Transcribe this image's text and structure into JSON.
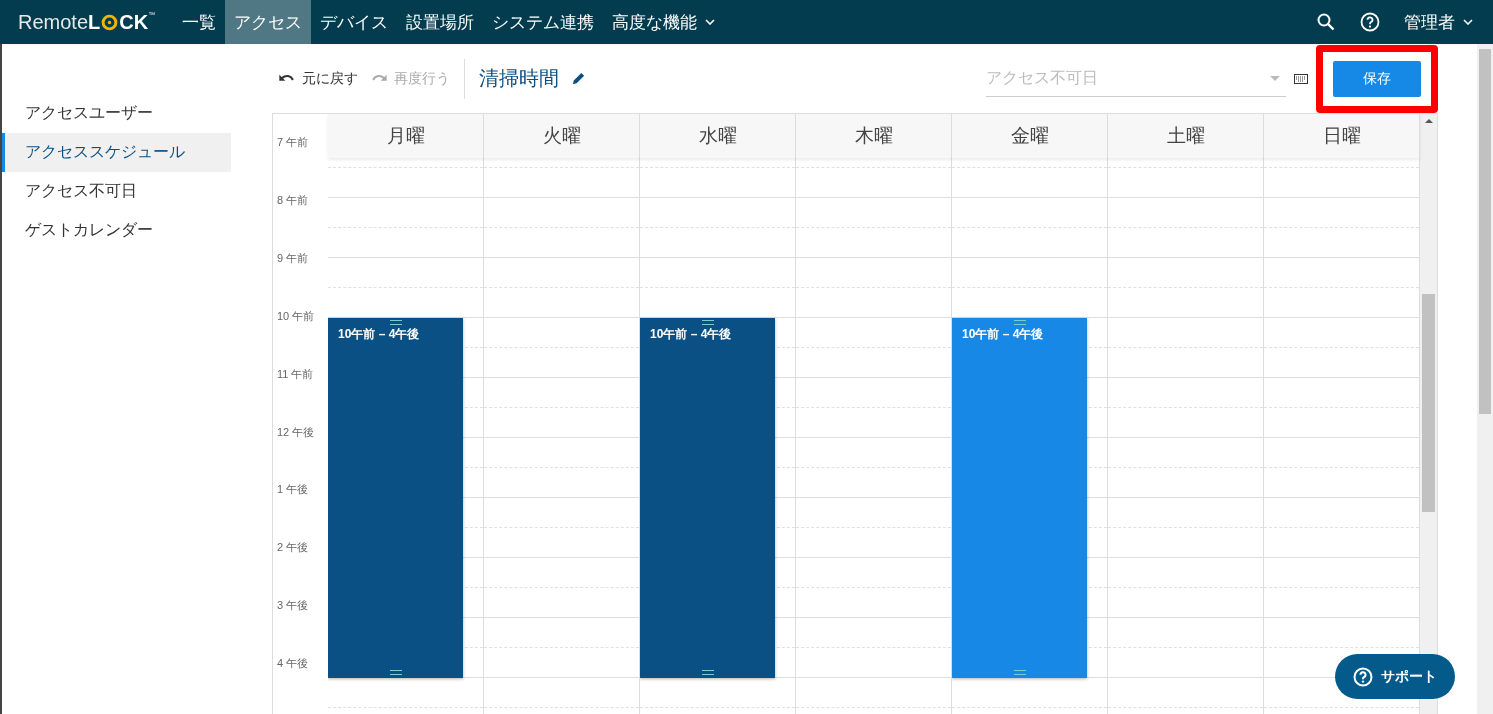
{
  "logo": {
    "before": "Remote",
    "bold_start": "L",
    "bold_end": "CK",
    "mark": "™"
  },
  "nav": [
    {
      "label": "一覧",
      "selected": false,
      "kind": "link"
    },
    {
      "label": "アクセス",
      "selected": true,
      "kind": "link"
    },
    {
      "label": "デバイス",
      "selected": false,
      "kind": "link"
    },
    {
      "label": "設置場所",
      "selected": false,
      "kind": "link"
    },
    {
      "label": "システム連携",
      "selected": false,
      "kind": "link"
    },
    {
      "label": "高度な機能",
      "selected": false,
      "kind": "menu"
    }
  ],
  "user_menu": {
    "label": "管理者"
  },
  "sidebar": {
    "items": [
      {
        "label": "アクセスユーザー",
        "selected": false
      },
      {
        "label": "アクセススケジュール",
        "selected": true
      },
      {
        "label": "アクセス不可日",
        "selected": false
      },
      {
        "label": "ゲストカレンダー",
        "selected": false
      }
    ]
  },
  "toolbar": {
    "undo": {
      "label": "元に戻す",
      "disabled": false
    },
    "redo": {
      "label": "再度行う",
      "disabled": true
    },
    "title": "清掃時間",
    "exceptions": {
      "placeholder": "アクセス不可日"
    },
    "save": {
      "label": "保存",
      "highlighted": true
    }
  },
  "calendar": {
    "times": [
      "7 午前",
      "8 午前",
      "9 午前",
      "10 午前",
      "11 午前",
      "12 午後",
      "1 午後",
      "2 午後",
      "3 午後",
      "4 午後"
    ],
    "days": [
      {
        "label": "月曜",
        "events": [
          {
            "label": "10午前 – 4午後",
            "selected": false
          }
        ]
      },
      {
        "label": "火曜"
      },
      {
        "label": "水曜",
        "events": [
          {
            "label": "10午前 – 4午後",
            "selected": false
          }
        ]
      },
      {
        "label": "木曜"
      },
      {
        "label": "金曜",
        "events": [
          {
            "label": "10午前 – 4午後",
            "selected": true
          }
        ]
      },
      {
        "label": "土曜"
      },
      {
        "label": "日曜"
      }
    ]
  },
  "support": {
    "label": "サポート"
  }
}
